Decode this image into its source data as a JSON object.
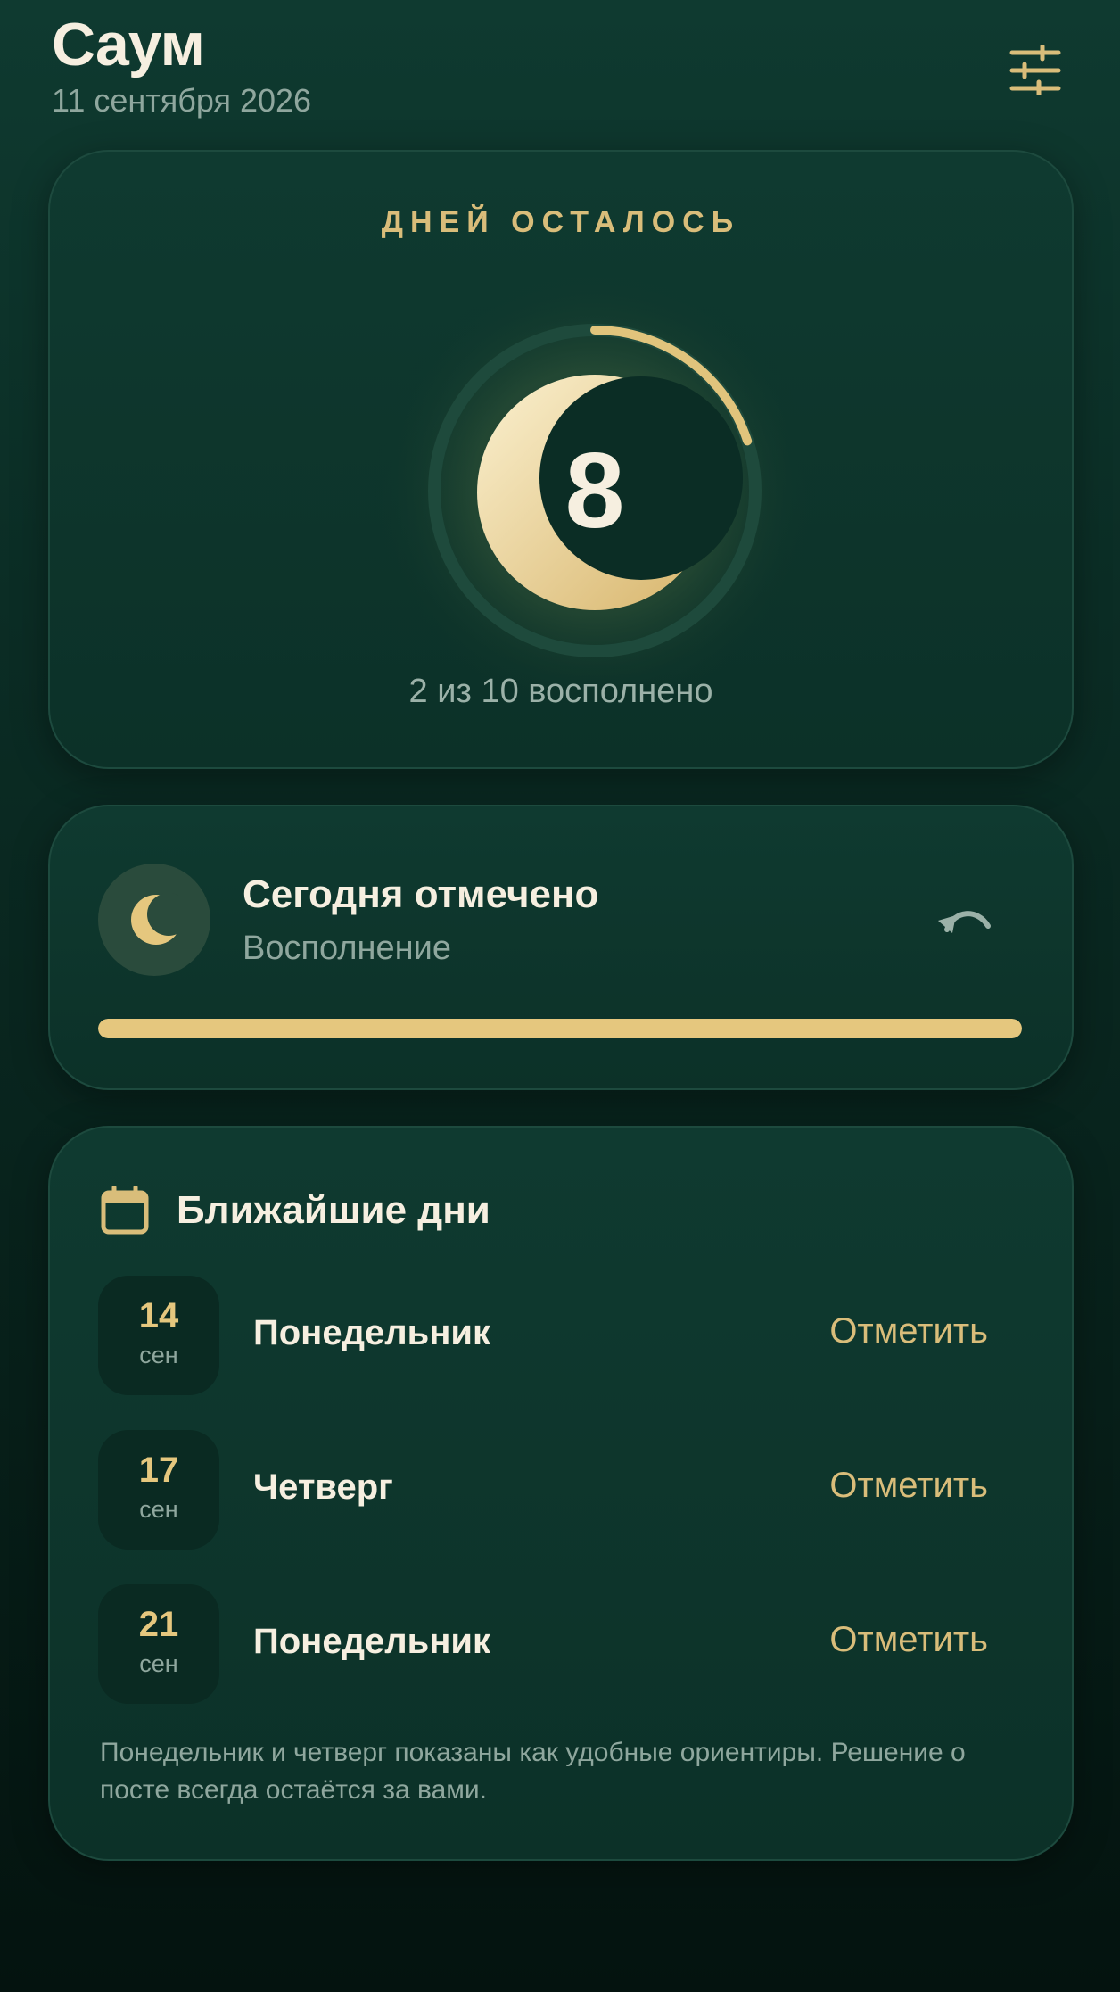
{
  "app": {
    "title": "Саум",
    "date": "11 сентября 2026"
  },
  "days_remaining": {
    "label": "ДНЕЙ ОСТАЛОСЬ",
    "count": "8",
    "progress_text": "2 из 10 восполнено",
    "completed": 2,
    "total": 10
  },
  "today": {
    "title": "Сегодня отмечено",
    "subtitle": "Восполнение",
    "progress_fraction": 1.0
  },
  "upcoming": {
    "title": "Ближайшие дни",
    "days": [
      {
        "day": "14",
        "month": "сен",
        "weekday": "Понедельник",
        "action": "Отметить"
      },
      {
        "day": "17",
        "month": "сен",
        "weekday": "Четверг",
        "action": "Отметить"
      },
      {
        "day": "21",
        "month": "сен",
        "weekday": "Понедельник",
        "action": "Отметить"
      }
    ],
    "note": "Понедельник и четверг показаны как удобные ориентиры. Решение о посте всегда остаётся за вами."
  },
  "icons": {
    "settings": "sliders-icon",
    "moon": "crescent-moon-icon",
    "undo": "undo-icon",
    "calendar": "calendar-icon"
  },
  "colors": {
    "accent": "#e5c77e",
    "background": "#0b2d25",
    "text": "#f6efe0",
    "muted": "#8fa79e"
  }
}
